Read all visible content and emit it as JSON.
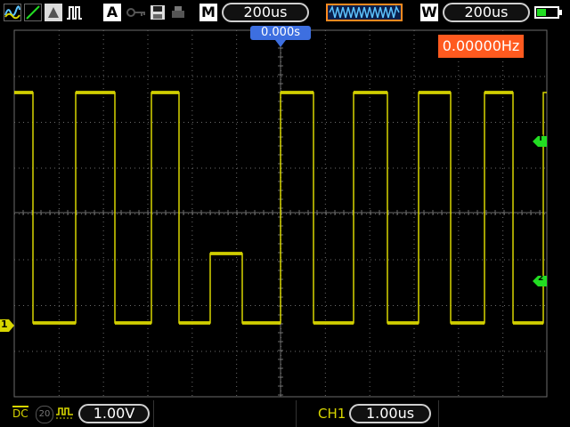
{
  "toolbar": {
    "icons": [
      "wave-icon",
      "line-icon",
      "cursor-icon",
      "pulse-icon",
      "auto-icon",
      "key-icon",
      "save-icon",
      "print-icon"
    ],
    "auto_label": "A",
    "mode_label": "M",
    "timebase": "200us",
    "window_label": "W",
    "window_timebase": "200us",
    "battery": "battery-icon"
  },
  "trigger": {
    "time_offset": "0.000s",
    "frequency": "0.00000Hz"
  },
  "channel": {
    "marker": "1",
    "coupling": "DC",
    "bw_label": "20",
    "volts_div": "1.00V"
  },
  "bottom": {
    "channel_label": "CH1",
    "time_div": "1.00us"
  },
  "side_markers": {
    "trigger_level": "T",
    "ch2_marker": "2"
  },
  "colors": {
    "trace": "#d8d600",
    "grid": "#6b6b6b",
    "accent_freq": "#ff5a1f",
    "trigger_marker": "#3d6fe0",
    "side_marker": "#22dd22"
  }
}
